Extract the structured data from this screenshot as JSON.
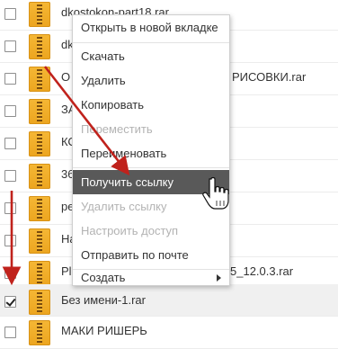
{
  "files": [
    {
      "name": "dkostokon-part18.rar",
      "checked": false
    },
    {
      "name": "dk",
      "checked": false
    },
    {
      "name": "О",
      "checked": false
    },
    {
      "name": "ЗА",
      "checked": false
    },
    {
      "name": "КС",
      "checked": false
    },
    {
      "name": "36",
      "checked": false
    },
    {
      "name": "ре",
      "checked": false
    },
    {
      "name": "На",
      "checked": false
    },
    {
      "name": "Pl",
      "checked": false
    },
    {
      "name": "Без имени-1.rar",
      "checked": true
    },
    {
      "name": "МАКИ РИШЕРЬ",
      "checked": false
    }
  ],
  "partial_names": {
    "row3_suffix": "РИСОВКИ.rar",
    "row9_suffix": "5_12.0.3.rar"
  },
  "context_menu": {
    "items": [
      {
        "label": "Открыть в новой вкладке",
        "state": "enabled"
      },
      {
        "label": "Скачать",
        "state": "enabled"
      },
      {
        "label": "Удалить",
        "state": "enabled"
      },
      {
        "label": "Копировать",
        "state": "enabled"
      },
      {
        "label": "Переместить",
        "state": "disabled"
      },
      {
        "label": "Переименовать",
        "state": "enabled"
      },
      {
        "label": "Получить ссылку",
        "state": "highlighted"
      },
      {
        "label": "Удалить ссылку",
        "state": "disabled"
      },
      {
        "label": "Настроить доступ",
        "state": "disabled"
      },
      {
        "label": "Отправить по почте",
        "state": "enabled"
      },
      {
        "label": "Создать",
        "state": "enabled",
        "submenu": true
      }
    ]
  },
  "colors": {
    "highlight": "#595959",
    "annotation_arrow": "#c0221c",
    "archive_icon": "#f5b735"
  },
  "icons": {
    "file_icon": "archive-icon",
    "cursor": "hand-pointer-icon",
    "submenu": "triangle-right-icon"
  }
}
